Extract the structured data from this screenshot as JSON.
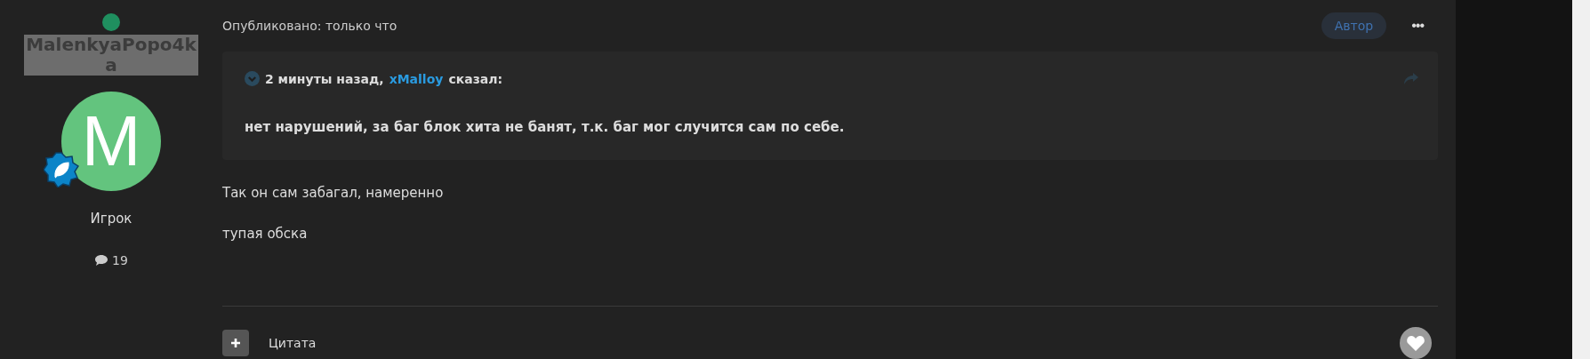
{
  "author": {
    "name": "MalenkyaPopo4ka",
    "online": true,
    "avatar_letter": "M",
    "role": "Игрок",
    "post_count": "19"
  },
  "post": {
    "published": "Опубликовано: только что",
    "author_badge": "Автор",
    "menu": "•••",
    "quote": {
      "time": "2 минуты назад,",
      "user": "xMalloy",
      "said": "сказал:",
      "text": "нет нарушений, за баг блок хита не банят, т.к. баг мог случится сам по себе."
    },
    "paragraphs": [
      "Так он сам забагал, намеренно",
      "тупая обска"
    ]
  },
  "footer": {
    "quote_button": "Цитата"
  }
}
